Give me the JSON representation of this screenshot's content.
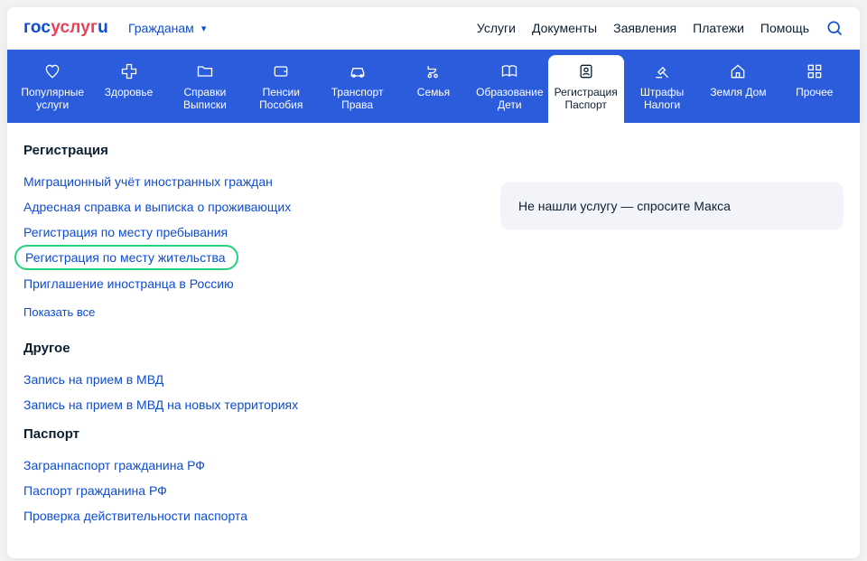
{
  "logo": {
    "part1": "гос",
    "part2": "услуг",
    "part3": "u"
  },
  "audience": {
    "label": "Гражданам"
  },
  "nav": {
    "services": "Услуги",
    "documents": "Документы",
    "applications": "Заявления",
    "payments": "Платежи",
    "help": "Помощь"
  },
  "categories": {
    "popular_l1": "Популярные",
    "popular_l2": "услуги",
    "health_l1": "Здоровье",
    "docs_l1": "Справки",
    "docs_l2": "Выписки",
    "pension_l1": "Пенсии",
    "pension_l2": "Пособия",
    "transport_l1": "Транспорт",
    "transport_l2": "Права",
    "family_l1": "Семья",
    "edu_l1": "Образование",
    "edu_l2": "Дети",
    "reg_l1": "Регистрация",
    "reg_l2": "Паспорт",
    "fines_l1": "Штрафы",
    "fines_l2": "Налоги",
    "land_l1": "Земля Дом",
    "other_l1": "Прочее"
  },
  "sections": {
    "registration_title": "Регистрация",
    "reg_links": {
      "i0": "Миграционный учёт иностранных граждан",
      "i1": "Адресная справка и выписка о проживающих",
      "i2": "Регистрация по месту пребывания",
      "i3": "Регистрация по месту жительства",
      "i4": "Приглашение иностранца в Россию"
    },
    "show_all": "Показать все",
    "other_title": "Другое",
    "other_links": {
      "i0": "Запись на прием в МВД",
      "i1": "Запись на прием в МВД на новых территориях"
    },
    "passport_title": "Паспорт",
    "passport_links": {
      "i0": "Загранпаспорт гражданина РФ",
      "i1": "Паспорт гражданина РФ",
      "i2": "Проверка действительности паспорта"
    }
  },
  "hint": {
    "text": "Не нашли услугу — спросите Макса"
  }
}
